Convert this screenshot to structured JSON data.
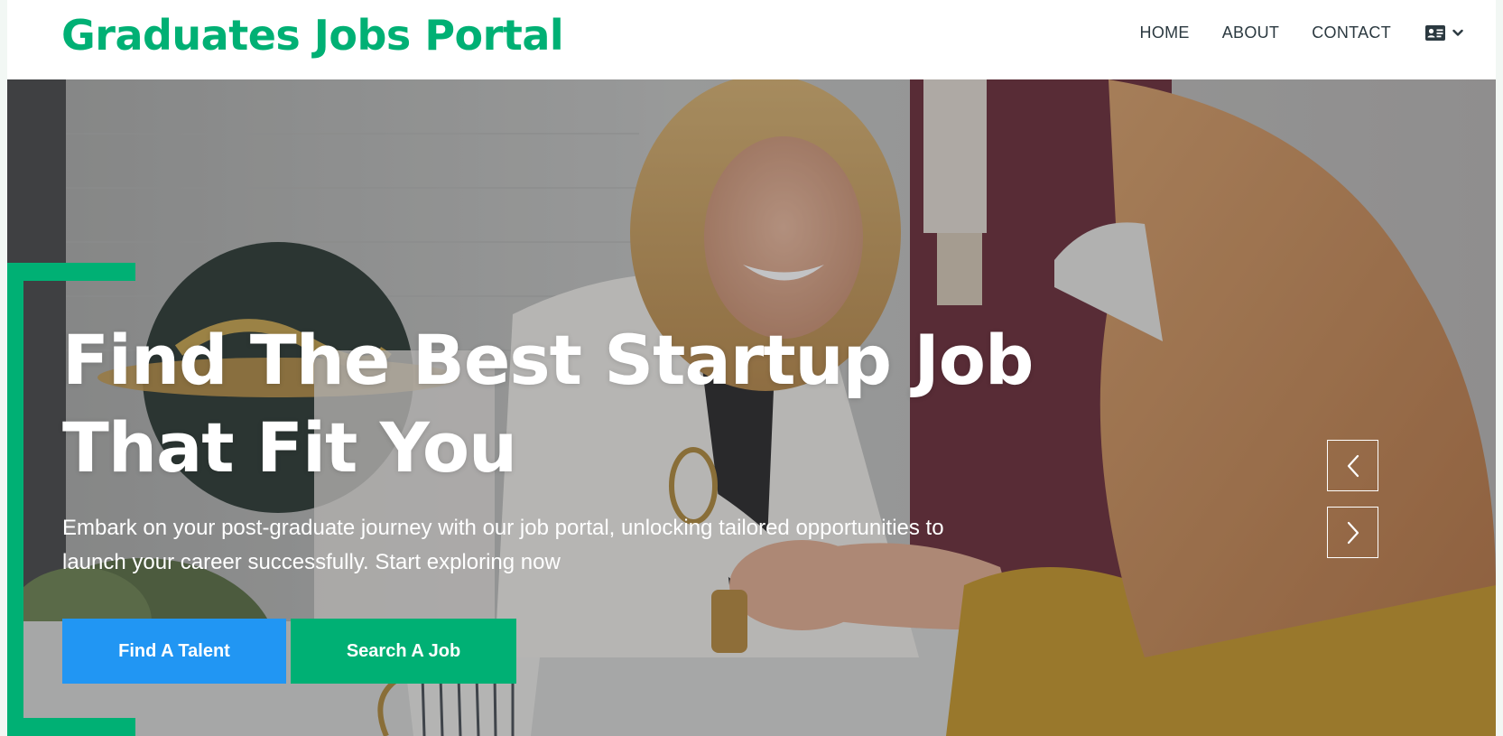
{
  "brand": {
    "title": "Graduates Jobs Portal"
  },
  "nav": {
    "items": [
      {
        "label": "HOME"
      },
      {
        "label": "ABOUT"
      },
      {
        "label": "CONTACT"
      }
    ],
    "profile_icon": "id-card-icon",
    "dropdown_icon": "chevron-down-icon"
  },
  "hero": {
    "headline_line1": "Find The Best Startup Job",
    "headline_line2": "That Fit You",
    "subtext_line1": "Embark on your post-graduate journey with our job portal, unlocking tailored opportunities to",
    "subtext_line2": "launch your career successfully. Start exploring now",
    "buttons": {
      "find_talent": "Find A Talent",
      "search_job": "Search A Job"
    },
    "carousel": {
      "prev_icon": "chevron-left-icon",
      "next_icon": "chevron-right-icon"
    }
  },
  "colors": {
    "brand_green": "#00b074",
    "accent_blue": "#2196f3",
    "nav_text": "#2b3940"
  }
}
